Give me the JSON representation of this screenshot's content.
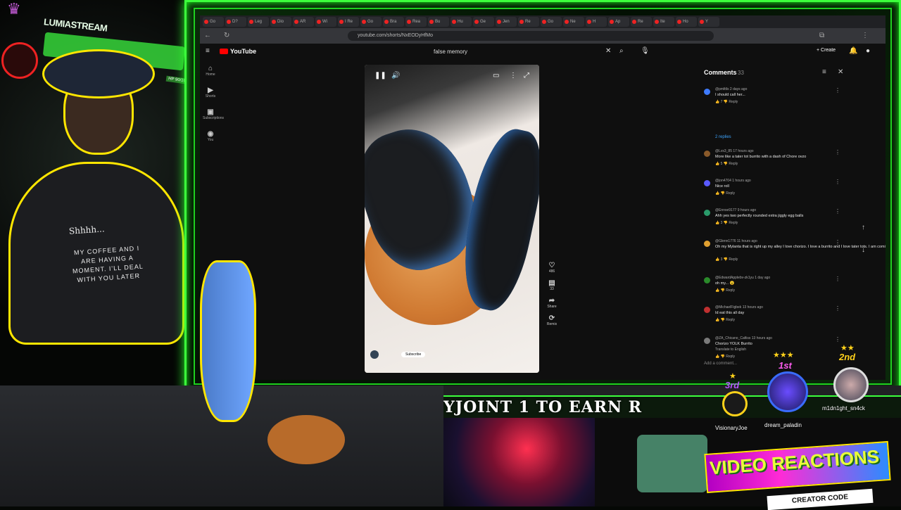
{
  "stream": {
    "overlay_brand": "LUMIASTREAM",
    "hp_label": "HP 90/100",
    "shirt_line1": "Shhhh...",
    "shirt_line2": "MY COFFEE AND I ARE HAVING A MOMENT. I'LL DEAL WITH YOU LATER",
    "ticker_text": "YJOINT 1 TO EARN R",
    "banner": "VIDEO REACTIONS",
    "creator_code": "CREATOR CODE"
  },
  "leaderboard": [
    {
      "rank": "1st",
      "name": "dream_paladin",
      "stars": "★★★"
    },
    {
      "rank": "2nd",
      "name": "m1dn1ght_sn4ck",
      "stars": "★★"
    },
    {
      "rank": "3rd",
      "name": "VisionaryJoe",
      "stars": "★"
    }
  ],
  "browser": {
    "url": "youtube.com/shorts/NxEODyHfMo",
    "tabs": [
      "Go",
      "D?",
      "Leg",
      "Dio",
      "AR",
      "Wi",
      "I Re",
      "Go",
      "Bra",
      "Rea",
      "Bu",
      "Hu",
      "Ge",
      "Jen",
      "Re",
      "Go",
      "Ne",
      "H",
      "Ap",
      "Re",
      "Ite",
      "Ho",
      "Y"
    ]
  },
  "youtube": {
    "logo": "YouTube",
    "search_query": "false memory",
    "create_label": "+ Create",
    "sidebar": [
      {
        "icon": "⌂",
        "label": "Home"
      },
      {
        "icon": "▶",
        "label": "Shorts"
      },
      {
        "icon": "▣",
        "label": "Subscriptions"
      },
      {
        "icon": "◉",
        "label": "You"
      }
    ],
    "video": {
      "subscribe_label": "Subscribe"
    },
    "actions": [
      {
        "icon": "♡",
        "label": "486"
      },
      {
        "icon": "▤",
        "label": "33"
      },
      {
        "icon": "➦",
        "label": "Share"
      },
      {
        "icon": "⟳",
        "label": "Remix"
      }
    ]
  },
  "comments": {
    "title": "Comments",
    "count": "33",
    "replies_label": "2 replies",
    "add_placeholder": "Add a comment...",
    "items": [
      {
        "user": "@pmlttls 2 days ago",
        "text": "I should call her...",
        "likes": "7",
        "color": "#3e7bff"
      },
      {
        "user": "@Lvs3_85 17 hours ago",
        "text": "More like a tater tot burrito with a dash of Chore ovzo",
        "likes": "5",
        "color": "#8a5a2a"
      },
      {
        "user": "@jon4704 1 hours ago",
        "text": "Nice roll",
        "likes": "",
        "color": "#5a5aff"
      },
      {
        "user": "@Ennse9177 9 hours ago",
        "text": "Ahh yes two perfectly rounded extra jiggly egg balls",
        "likes": "3",
        "color": "#2a9a6a"
      },
      {
        "user": "@Glenn1776 11 hours ago",
        "text": "Oh my Mylanta that is right up my alley I love chorizo. I love a burrito and I love tater tots. I am coming. Ozempic.",
        "likes": "3",
        "color": "#e0a030"
      },
      {
        "user": "@EdwardApplebv-zk1yu 1 day ago",
        "text": "oh my... 😮",
        "likes": "",
        "color": "#2a8a2a"
      },
      {
        "user": "@MichaelFigbek 13 hours ago",
        "text": "Id eat this all day",
        "likes": "",
        "color": "#c03030"
      },
      {
        "user": "@ZA_Chicano_Cafiiss 13 hours ago",
        "text": "Chorizo YOLK Burrito",
        "likes": "",
        "color": "#7a7a7a",
        "translate": "Translate to English"
      }
    ]
  }
}
